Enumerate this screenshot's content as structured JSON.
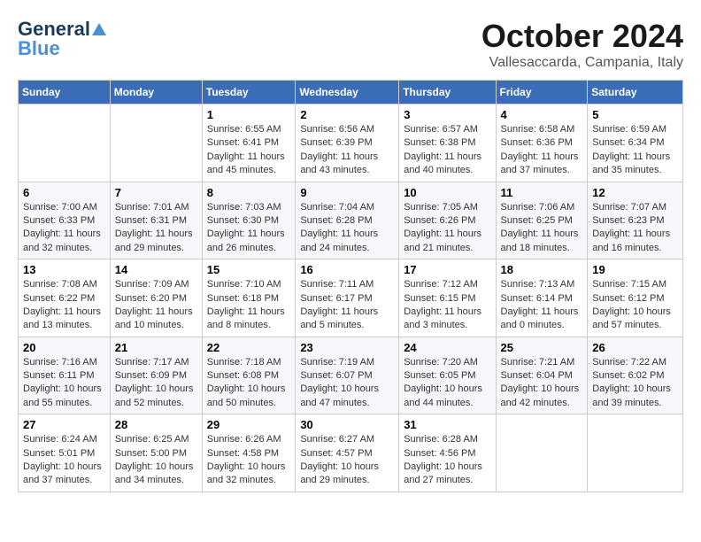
{
  "header": {
    "logo_general": "General",
    "logo_blue": "Blue",
    "month": "October 2024",
    "location": "Vallesaccarda, Campania, Italy"
  },
  "weekdays": [
    "Sunday",
    "Monday",
    "Tuesday",
    "Wednesday",
    "Thursday",
    "Friday",
    "Saturday"
  ],
  "weeks": [
    [
      {
        "day": "",
        "info": ""
      },
      {
        "day": "",
        "info": ""
      },
      {
        "day": "1",
        "sunrise": "Sunrise: 6:55 AM",
        "sunset": "Sunset: 6:41 PM",
        "daylight": "Daylight: 11 hours and 45 minutes."
      },
      {
        "day": "2",
        "sunrise": "Sunrise: 6:56 AM",
        "sunset": "Sunset: 6:39 PM",
        "daylight": "Daylight: 11 hours and 43 minutes."
      },
      {
        "day": "3",
        "sunrise": "Sunrise: 6:57 AM",
        "sunset": "Sunset: 6:38 PM",
        "daylight": "Daylight: 11 hours and 40 minutes."
      },
      {
        "day": "4",
        "sunrise": "Sunrise: 6:58 AM",
        "sunset": "Sunset: 6:36 PM",
        "daylight": "Daylight: 11 hours and 37 minutes."
      },
      {
        "day": "5",
        "sunrise": "Sunrise: 6:59 AM",
        "sunset": "Sunset: 6:34 PM",
        "daylight": "Daylight: 11 hours and 35 minutes."
      }
    ],
    [
      {
        "day": "6",
        "sunrise": "Sunrise: 7:00 AM",
        "sunset": "Sunset: 6:33 PM",
        "daylight": "Daylight: 11 hours and 32 minutes."
      },
      {
        "day": "7",
        "sunrise": "Sunrise: 7:01 AM",
        "sunset": "Sunset: 6:31 PM",
        "daylight": "Daylight: 11 hours and 29 minutes."
      },
      {
        "day": "8",
        "sunrise": "Sunrise: 7:03 AM",
        "sunset": "Sunset: 6:30 PM",
        "daylight": "Daylight: 11 hours and 26 minutes."
      },
      {
        "day": "9",
        "sunrise": "Sunrise: 7:04 AM",
        "sunset": "Sunset: 6:28 PM",
        "daylight": "Daylight: 11 hours and 24 minutes."
      },
      {
        "day": "10",
        "sunrise": "Sunrise: 7:05 AM",
        "sunset": "Sunset: 6:26 PM",
        "daylight": "Daylight: 11 hours and 21 minutes."
      },
      {
        "day": "11",
        "sunrise": "Sunrise: 7:06 AM",
        "sunset": "Sunset: 6:25 PM",
        "daylight": "Daylight: 11 hours and 18 minutes."
      },
      {
        "day": "12",
        "sunrise": "Sunrise: 7:07 AM",
        "sunset": "Sunset: 6:23 PM",
        "daylight": "Daylight: 11 hours and 16 minutes."
      }
    ],
    [
      {
        "day": "13",
        "sunrise": "Sunrise: 7:08 AM",
        "sunset": "Sunset: 6:22 PM",
        "daylight": "Daylight: 11 hours and 13 minutes."
      },
      {
        "day": "14",
        "sunrise": "Sunrise: 7:09 AM",
        "sunset": "Sunset: 6:20 PM",
        "daylight": "Daylight: 11 hours and 10 minutes."
      },
      {
        "day": "15",
        "sunrise": "Sunrise: 7:10 AM",
        "sunset": "Sunset: 6:18 PM",
        "daylight": "Daylight: 11 hours and 8 minutes."
      },
      {
        "day": "16",
        "sunrise": "Sunrise: 7:11 AM",
        "sunset": "Sunset: 6:17 PM",
        "daylight": "Daylight: 11 hours and 5 minutes."
      },
      {
        "day": "17",
        "sunrise": "Sunrise: 7:12 AM",
        "sunset": "Sunset: 6:15 PM",
        "daylight": "Daylight: 11 hours and 3 minutes."
      },
      {
        "day": "18",
        "sunrise": "Sunrise: 7:13 AM",
        "sunset": "Sunset: 6:14 PM",
        "daylight": "Daylight: 11 hours and 0 minutes."
      },
      {
        "day": "19",
        "sunrise": "Sunrise: 7:15 AM",
        "sunset": "Sunset: 6:12 PM",
        "daylight": "Daylight: 10 hours and 57 minutes."
      }
    ],
    [
      {
        "day": "20",
        "sunrise": "Sunrise: 7:16 AM",
        "sunset": "Sunset: 6:11 PM",
        "daylight": "Daylight: 10 hours and 55 minutes."
      },
      {
        "day": "21",
        "sunrise": "Sunrise: 7:17 AM",
        "sunset": "Sunset: 6:09 PM",
        "daylight": "Daylight: 10 hours and 52 minutes."
      },
      {
        "day": "22",
        "sunrise": "Sunrise: 7:18 AM",
        "sunset": "Sunset: 6:08 PM",
        "daylight": "Daylight: 10 hours and 50 minutes."
      },
      {
        "day": "23",
        "sunrise": "Sunrise: 7:19 AM",
        "sunset": "Sunset: 6:07 PM",
        "daylight": "Daylight: 10 hours and 47 minutes."
      },
      {
        "day": "24",
        "sunrise": "Sunrise: 7:20 AM",
        "sunset": "Sunset: 6:05 PM",
        "daylight": "Daylight: 10 hours and 44 minutes."
      },
      {
        "day": "25",
        "sunrise": "Sunrise: 7:21 AM",
        "sunset": "Sunset: 6:04 PM",
        "daylight": "Daylight: 10 hours and 42 minutes."
      },
      {
        "day": "26",
        "sunrise": "Sunrise: 7:22 AM",
        "sunset": "Sunset: 6:02 PM",
        "daylight": "Daylight: 10 hours and 39 minutes."
      }
    ],
    [
      {
        "day": "27",
        "sunrise": "Sunrise: 6:24 AM",
        "sunset": "Sunset: 5:01 PM",
        "daylight": "Daylight: 10 hours and 37 minutes."
      },
      {
        "day": "28",
        "sunrise": "Sunrise: 6:25 AM",
        "sunset": "Sunset: 5:00 PM",
        "daylight": "Daylight: 10 hours and 34 minutes."
      },
      {
        "day": "29",
        "sunrise": "Sunrise: 6:26 AM",
        "sunset": "Sunset: 4:58 PM",
        "daylight": "Daylight: 10 hours and 32 minutes."
      },
      {
        "day": "30",
        "sunrise": "Sunrise: 6:27 AM",
        "sunset": "Sunset: 4:57 PM",
        "daylight": "Daylight: 10 hours and 29 minutes."
      },
      {
        "day": "31",
        "sunrise": "Sunrise: 6:28 AM",
        "sunset": "Sunset: 4:56 PM",
        "daylight": "Daylight: 10 hours and 27 minutes."
      },
      {
        "day": "",
        "info": ""
      },
      {
        "day": "",
        "info": ""
      }
    ]
  ]
}
